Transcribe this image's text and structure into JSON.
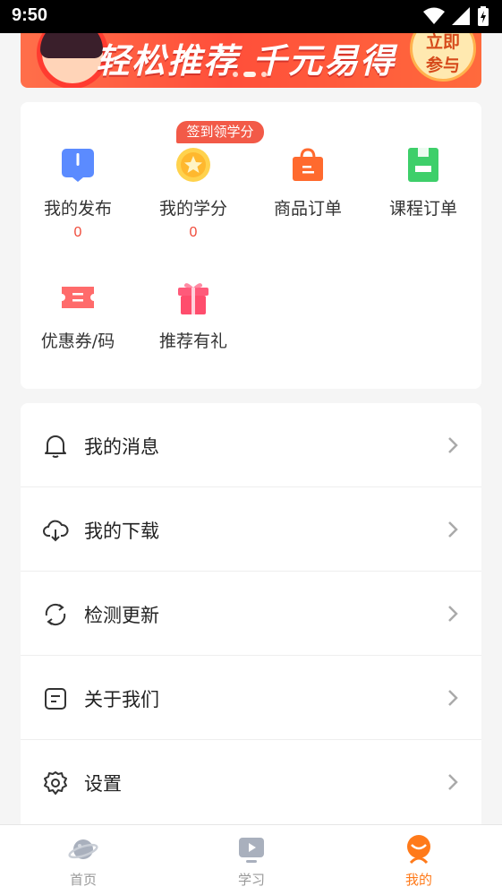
{
  "status_bar": {
    "time": "9:50",
    "icons": [
      "wifi-icon",
      "signal-icon",
      "battery-charging-icon"
    ]
  },
  "banner": {
    "slogan": "轻松推荐 千元易得",
    "join_line1": "立即",
    "join_line2": "参与",
    "slide_count": 3,
    "active_slide": 1
  },
  "shortcuts": {
    "badge": "签到领学分",
    "items": [
      {
        "label": "我的发布",
        "count": "0",
        "icon": "publish-icon"
      },
      {
        "label": "我的学分",
        "count": "0",
        "icon": "credit-star-icon"
      },
      {
        "label": "商品订单",
        "icon": "shopping-bag-icon"
      },
      {
        "label": "课程订单",
        "icon": "course-book-icon"
      },
      {
        "label": "优惠券/码",
        "icon": "coupon-icon"
      },
      {
        "label": "推荐有礼",
        "icon": "gift-icon"
      }
    ]
  },
  "menu": [
    {
      "label": "我的消息",
      "icon": "bell-icon"
    },
    {
      "label": "我的下载",
      "icon": "cloud-download-icon"
    },
    {
      "label": "检测更新",
      "icon": "refresh-icon"
    },
    {
      "label": "关于我们",
      "icon": "document-icon"
    },
    {
      "label": "设置",
      "icon": "gear-icon"
    }
  ],
  "tabbar": [
    {
      "label": "首页",
      "icon": "planet-icon",
      "active": false
    },
    {
      "label": "学习",
      "icon": "play-screen-icon",
      "active": false
    },
    {
      "label": "我的",
      "icon": "profile-face-icon",
      "active": true
    }
  ],
  "colors": {
    "accent": "#ff7a1a",
    "count_red": "#f04a3a",
    "badge_red": "#f25a48",
    "banner_red": "#ff4f3a"
  }
}
